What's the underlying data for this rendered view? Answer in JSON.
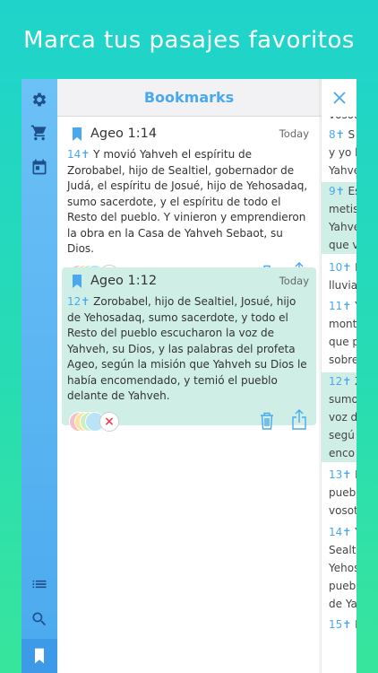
{
  "headline": "Marca tus pasajes favoritos",
  "sidebar": {
    "items": [
      {
        "icon": "gear-icon"
      },
      {
        "icon": "cart-icon"
      },
      {
        "icon": "calendar-icon"
      },
      {
        "icon": "list-icon"
      },
      {
        "icon": "search-icon"
      },
      {
        "icon": "bookmark-icon",
        "active": true
      }
    ]
  },
  "bookmarks": {
    "title": "Bookmarks",
    "cards": [
      {
        "ref": "Ageo 1:14",
        "date": "Today",
        "verse_num": "14",
        "text": "Y movió Yahveh el espíritu de Zorobabel, hijo de Sealtiel, gobernador de Judá, el espíritu de Josué, hijo de Yehosadaq, sumo sacerdote, y el espíritu de todo el Resto del pueblo. Y vinieron y emprendieron la obra en la Casa de Yahveh Sebaot, su Dios.",
        "highlight": "#ffffff"
      },
      {
        "ref": "Ageo 1:12",
        "date": "Today",
        "verse_num": "12",
        "text": "Zorobabel, hijo de Sealtiel, Josué, hijo de Yehosadaq, sumo sacerdote, y todo el Resto del pueblo escucharon la voz de Yahveh, su Dios, y las palabras del profeta Ageo, según la misión que Yahveh su Dios le había encomendado, y temió el pueblo delante de Yahveh.",
        "highlight": "#cfeee6"
      }
    ],
    "dot_colors": [
      "#f7c0c8",
      "#fbe3a0",
      "#c9f0c2",
      "#b9e3f7"
    ],
    "cross_mark": "×",
    "verse_mark": "✝"
  },
  "reader": {
    "close_icon": "close-icon",
    "lines": [
      {
        "num": "",
        "text": "vosot",
        "hl": false
      },
      {
        "num": "8",
        "text": "S",
        "hl": false
      },
      {
        "num": "",
        "text": "y yo l",
        "hl": false
      },
      {
        "num": "",
        "text": "Yahve",
        "hl": false
      },
      {
        "num": "9",
        "text": "Es",
        "hl": true
      },
      {
        "num": "",
        "text": "metis",
        "hl": true
      },
      {
        "num": "",
        "text": "Yahve",
        "hl": true
      },
      {
        "num": "",
        "text": "que v",
        "hl": true
      },
      {
        "num": "10",
        "text": "I",
        "hl": false
      },
      {
        "num": "",
        "text": "lluvia",
        "hl": false
      },
      {
        "num": "11",
        "text": "Y",
        "hl": false
      },
      {
        "num": "",
        "text": "mont",
        "hl": false
      },
      {
        "num": "",
        "text": "que p",
        "hl": false
      },
      {
        "num": "",
        "text": "sobre",
        "hl": false
      },
      {
        "num": "12",
        "text": "Z",
        "hl": true
      },
      {
        "num": "",
        "text": "sumo",
        "hl": true
      },
      {
        "num": "",
        "text": "voz d",
        "hl": true
      },
      {
        "num": "",
        "text": "segú",
        "hl": true
      },
      {
        "num": "",
        "text": "enco",
        "hl": true
      },
      {
        "num": "13",
        "text": "I",
        "hl": false
      },
      {
        "num": "",
        "text": "pueb",
        "hl": false
      },
      {
        "num": "",
        "text": "vosot",
        "hl": false
      },
      {
        "num": "14",
        "text": "Y",
        "hl": false
      },
      {
        "num": "",
        "text": "Sealt",
        "hl": false
      },
      {
        "num": "",
        "text": "Yehos",
        "hl": false
      },
      {
        "num": "",
        "text": "pueb",
        "hl": false
      },
      {
        "num": "",
        "text": "de Ya",
        "hl": false
      },
      {
        "num": "15",
        "text": "E",
        "hl": false
      }
    ]
  }
}
